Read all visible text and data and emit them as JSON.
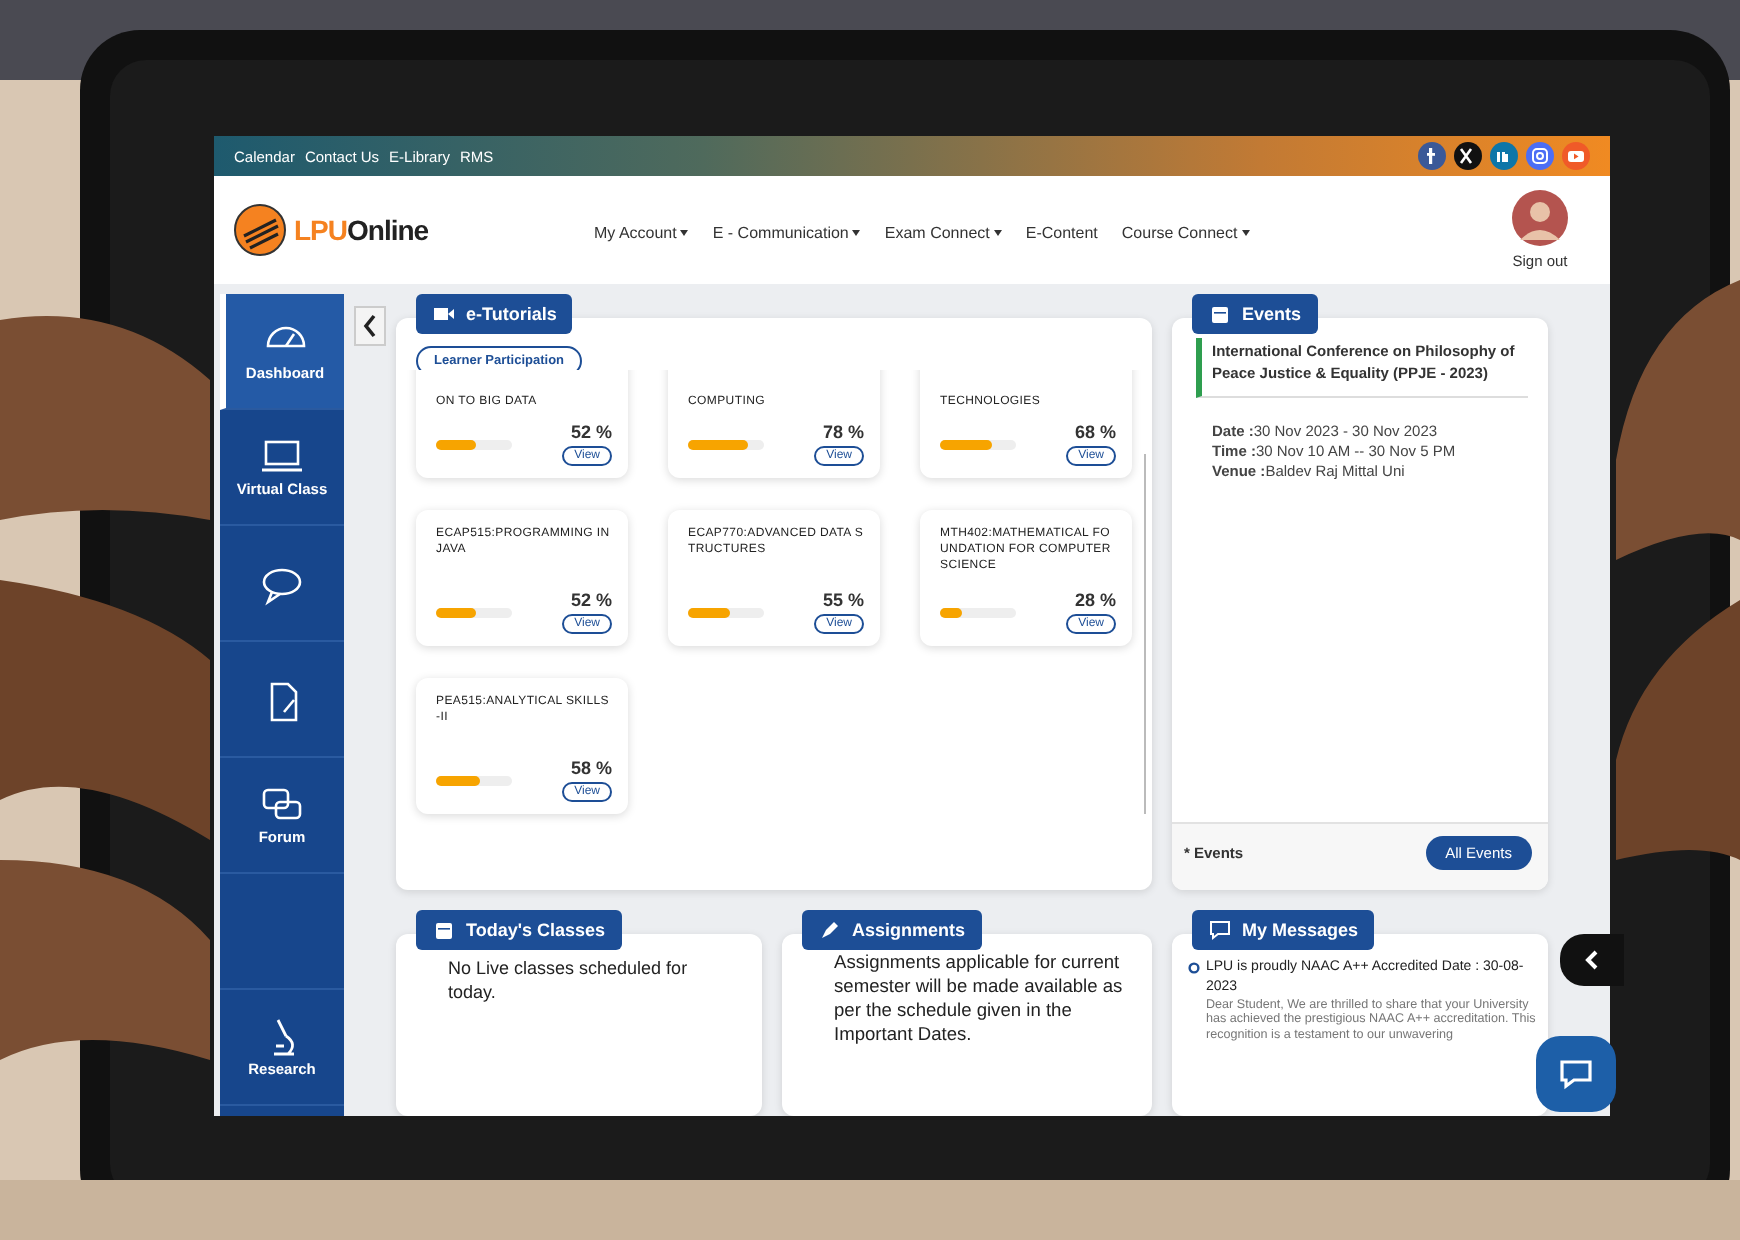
{
  "topbar": {
    "links": [
      "Calendar",
      "Contact Us",
      "E-Library",
      "RMS"
    ],
    "socials": [
      {
        "kind": "facebook",
        "color": "#3b5998"
      },
      {
        "kind": "x",
        "color": "#111111"
      },
      {
        "kind": "linkedin",
        "color": "#0e76a8"
      },
      {
        "kind": "instagram",
        "color": "#4c6ef5"
      },
      {
        "kind": "youtube",
        "color": "#f05a28"
      }
    ]
  },
  "header": {
    "logo": {
      "brand_a": "LPU",
      "brand_b": "Online"
    },
    "nav": [
      {
        "label": "My Account",
        "dropdown": true
      },
      {
        "label": "E - Communication",
        "dropdown": true
      },
      {
        "label": "Exam Connect",
        "dropdown": true
      },
      {
        "label": "E-Content",
        "dropdown": false
      },
      {
        "label": "Course Connect",
        "dropdown": true
      }
    ],
    "user": {
      "action": "Sign out"
    }
  },
  "sidebar": {
    "items": [
      {
        "kind": "dashboard",
        "label": "Dashboard",
        "selected": true
      },
      {
        "kind": "laptop",
        "label": "Virtual Class",
        "selected": false
      },
      {
        "kind": "chat",
        "selected": false
      },
      {
        "kind": "document",
        "selected": false
      },
      {
        "kind": "forum",
        "label": "Forum",
        "selected": false
      },
      {
        "kind": "blank",
        "selected": false
      },
      {
        "kind": "microscope",
        "label": "Research",
        "selected": false
      }
    ]
  },
  "tutorials": {
    "title": "e-Tutorials",
    "filter": "Learner Participation",
    "courses": [
      {
        "title": "ON TO BIG DATA",
        "percent": "52 %",
        "level": 0.52,
        "action": "View",
        "clipped": true
      },
      {
        "title": "COMPUTING",
        "percent": "78 %",
        "level": 0.78,
        "action": "View",
        "clipped": true
      },
      {
        "title": "TECHNOLOGIES",
        "percent": "68 %",
        "level": 0.68,
        "action": "View",
        "clipped": true
      },
      {
        "title": "ECAP515:PROGRAMMING IN JAVA",
        "percent": "52 %",
        "level": 0.52,
        "action": "View",
        "clipped": false
      },
      {
        "title": "ECAP770:ADVANCED DATA STRUCTURES",
        "percent": "55 %",
        "level": 0.55,
        "action": "View",
        "clipped": false
      },
      {
        "title": "MTH402:MATHEMATICAL FOUNDATION FOR COMPUTER SCIENCE",
        "percent": "28 %",
        "level": 0.28,
        "action": "View",
        "clipped": false
      },
      {
        "title": "PEA515:ANALYTICAL SKILLS-II",
        "percent": "58 %",
        "level": 0.58,
        "action": "View",
        "clipped": false
      }
    ]
  },
  "events": {
    "title": "Events",
    "event": {
      "name": "International Conference on Philosophy of Peace Justice & Equality (PPJE - 2023)",
      "details": [
        "**Date :**30 Nov 2023 - 30 Nov 2023",
        "**Time :**30 Nov 10 AM -- 30 Nov 5 PM",
        "**Venue :**Baldev Raj Mittal Uni"
      ]
    },
    "footer": "* Events",
    "action": "All Events"
  },
  "classes": {
    "title": "Today's Classes",
    "text": "No Live classes scheduled for today."
  },
  "assignments": {
    "title": "Assignments",
    "text": "Assignments applicable for current semester will be made available as per the schedule given in the Important Dates."
  },
  "messages": {
    "title": "My Messages",
    "items": [
      {
        "heading": "LPU is proudly NAAC A++ Accredited Date : 30-08-2023",
        "body": "Dear Student, We are thrilled to share that your University has achieved the prestigious NAAC A++ accreditation. This recognition is a testament to our unwavering"
      }
    ]
  }
}
